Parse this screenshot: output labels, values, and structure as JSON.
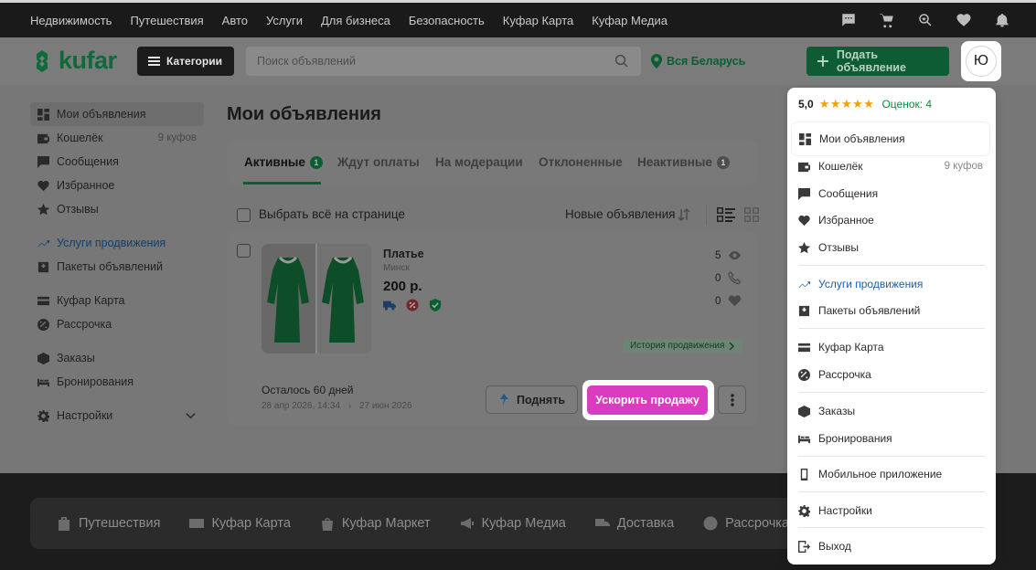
{
  "topnav": {
    "links": [
      "Недвижимость",
      "Путешествия",
      "Авто",
      "Услуги",
      "Для бизнеса",
      "Безопасность",
      "Куфар Карта",
      "Куфар Медиа"
    ],
    "icons": [
      "chat-icon",
      "cart-icon",
      "search-heart-icon",
      "heart-icon",
      "bell-icon"
    ]
  },
  "header": {
    "logo": "kufar",
    "categories_label": "Категории",
    "search_placeholder": "Поиск объявлений",
    "region": "Вся Беларусь",
    "post_label": "Подать объявление",
    "avatar_letter": "Ю"
  },
  "sidebar": {
    "items": [
      {
        "label": "Мои объявления",
        "icon": "grid-icon"
      },
      {
        "label": "Кошелёк",
        "count": "9 куфов",
        "icon": "wallet-icon"
      },
      {
        "label": "Сообщения",
        "icon": "message-icon"
      },
      {
        "label": "Избранное",
        "icon": "heart-icon"
      },
      {
        "label": "Отзывы",
        "icon": "star-icon"
      },
      {
        "label": "Услуги продвижения",
        "icon": "trend-icon"
      },
      {
        "label": "Пакеты объявлений",
        "icon": "package-icon"
      },
      {
        "label": "Куфар Карта",
        "icon": "card-icon"
      },
      {
        "label": "Рассрочка",
        "icon": "installment-icon"
      },
      {
        "label": "Заказы",
        "icon": "box-icon"
      },
      {
        "label": "Бронирования",
        "icon": "bed-icon"
      },
      {
        "label": "Настройки",
        "icon": "gear-icon"
      }
    ]
  },
  "main": {
    "title": "Мои объявления",
    "tabs": [
      {
        "label": "Активные",
        "badge": "1"
      },
      {
        "label": "Ждут оплаты"
      },
      {
        "label": "На модерации"
      },
      {
        "label": "Отклоненные"
      },
      {
        "label": "Неактивные",
        "badge": "1"
      }
    ],
    "select_all": "Выбрать всё на странице",
    "sort_label": "Новые объявления"
  },
  "listing": {
    "title": "Платье",
    "city": "Минск",
    "price": "200 р.",
    "views": "5",
    "calls": "0",
    "favorites": "0",
    "history_label": "История продвижения",
    "remaining": "Осталось 60 дней",
    "date_from": "28 апр 2026, 14:34",
    "date_to": "27 июн 2026",
    "raise_label": "Поднять",
    "boost_label": "Ускорить продажу"
  },
  "footer": {
    "items": [
      "Путешествия",
      "Куфар Карта",
      "Куфар Маркет",
      "Куфар Медиа",
      "Доставка",
      "Рассрочка"
    ]
  },
  "dropdown": {
    "rating": "5,0",
    "stars": "★★★★★",
    "reviews": "Оценок: 4",
    "items": [
      {
        "label": "Мои объявления",
        "icon": "grid-icon"
      },
      {
        "label": "Кошелёк",
        "count": "9 куфов",
        "icon": "wallet-icon"
      },
      {
        "label": "Сообщения",
        "icon": "message-icon"
      },
      {
        "label": "Избранное",
        "icon": "heart-icon"
      },
      {
        "label": "Отзывы",
        "icon": "star-icon"
      },
      {
        "label": "Услуги продвижения",
        "icon": "trend-icon"
      },
      {
        "label": "Пакеты объявлений",
        "icon": "package-icon"
      },
      {
        "label": "Куфар Карта",
        "icon": "card-icon"
      },
      {
        "label": "Рассрочка",
        "icon": "installment-icon"
      },
      {
        "label": "Заказы",
        "icon": "box-icon"
      },
      {
        "label": "Бронирования",
        "icon": "bed-icon"
      },
      {
        "label": "Мобильное приложение",
        "icon": "phone-icon"
      },
      {
        "label": "Настройки",
        "icon": "gear-icon"
      },
      {
        "label": "Выход",
        "icon": "logout-icon"
      }
    ]
  },
  "colors": {
    "brand_green": "#0d6b3b",
    "boost_pink": "#d93bc1",
    "star_gold": "#f5a000"
  }
}
